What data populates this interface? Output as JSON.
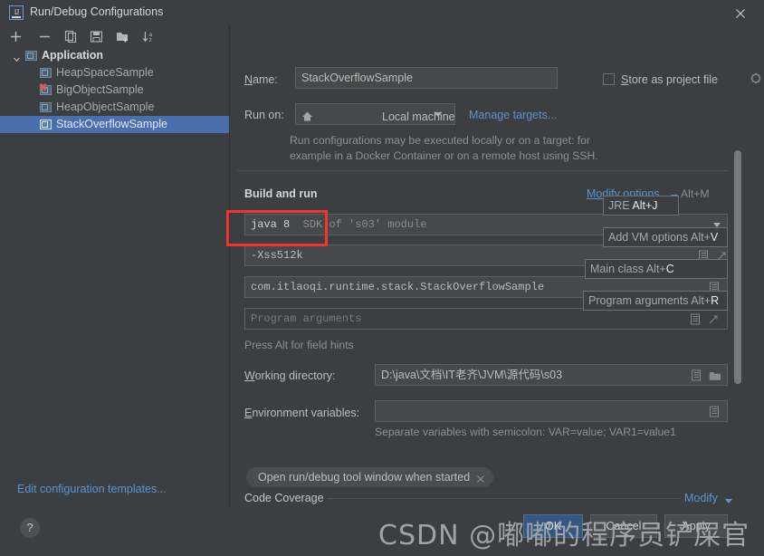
{
  "window": {
    "title": "Run/Debug Configurations",
    "app_icon": "intellij-idea-icon",
    "close_icon": "close-icon"
  },
  "toolbar": {
    "items": [
      {
        "name": "add-configuration-button",
        "icon": "plus-icon"
      },
      {
        "name": "remove-configuration-button",
        "icon": "minus-icon"
      },
      {
        "name": "copy-configuration-button",
        "icon": "copy-icon"
      },
      {
        "name": "save-configuration-button",
        "icon": "save-icon"
      },
      {
        "name": "new-folder-button",
        "icon": "folder-add-icon"
      },
      {
        "name": "sort-configurations-button",
        "icon": "sort-az-icon"
      }
    ]
  },
  "tree": {
    "root": {
      "label": "Application",
      "icon": "application-icon",
      "expanded": true
    },
    "items": [
      {
        "label": "HeapSpaceSample",
        "selected": false,
        "error": false
      },
      {
        "label": "BigObjectSample",
        "selected": false,
        "error": true,
        "error_badge": "✖"
      },
      {
        "label": "HeapObjectSample",
        "selected": false,
        "error": false
      },
      {
        "label": "StackOverflowSample",
        "selected": true,
        "error": false
      }
    ],
    "edit_templates_link": "Edit configuration templates..."
  },
  "form": {
    "name_label": "Name:",
    "name_label_mnemonic": "N",
    "name_value": "StackOverflowSample",
    "store_as_project_file_label": "Store as project file",
    "store_as_project_file_mnemonic": "S",
    "store_as_project_file_checked": false,
    "store_gear_icon": "gear-icon",
    "run_on_label": "Run on:",
    "run_on_value": "Local machine",
    "run_on_icon": "home-icon",
    "manage_targets_link": "Manage targets...",
    "run_on_help_line1": "Run configurations may be executed locally or on a target: for",
    "run_on_help_line2": "example in a Docker Container or on a remote host using SSH.",
    "build_and_run_title": "Build and run",
    "modify_options_link": "Modify options",
    "modify_options_shortcut": "Alt+M",
    "jre_value_prefix": "java 8",
    "jre_value_suffix": "SDK of 's03' module",
    "vm_options_value": "-Xss512k",
    "main_class_value": "com.itlaoqi.runtime.stack.StackOverflowSample",
    "program_arguments_placeholder": "Program arguments",
    "field_hints_note": "Press Alt for field hints",
    "working_directory_label": "Working directory:",
    "working_directory_mnemonic": "W",
    "working_directory_value": "D:\\java\\文档\\IT老齐\\JVM\\源代码\\s03",
    "environment_variables_label": "Environment variables:",
    "environment_variables_mnemonic": "E",
    "environment_variables_value": "",
    "environment_variables_help": "Separate variables with semicolon: VAR=value; VAR1=value1",
    "open_tool_window_chip": "Open run/debug tool window when started",
    "code_coverage_title": "Code Coverage",
    "code_coverage_modify_link": "Modify"
  },
  "hints": [
    {
      "name": "hint-jre",
      "text": "JRE ",
      "key": "Alt+J"
    },
    {
      "name": "hint-add-vm-options",
      "text": "Add VM options Alt+",
      "key": "V"
    },
    {
      "name": "hint-main-class",
      "text": "Main class Alt+",
      "key": "C"
    },
    {
      "name": "hint-program-arguments",
      "text": "Program arguments Alt+",
      "key": "R"
    }
  ],
  "footer": {
    "help_label": "?",
    "ok_label": "OK",
    "cancel_label": "Cancel",
    "apply_label": "Apply"
  },
  "watermark": {
    "text": "CSDN @嘟嘟的程序员铲屎官"
  },
  "colors": {
    "panel_bg": "#3c3f41",
    "selection_blue": "#4b6eaf",
    "link_blue": "#5894cf",
    "field_bg": "#45494a",
    "highlight_red": "#f4352e",
    "error_red": "#e05a4e",
    "primary_button": "#365880"
  }
}
